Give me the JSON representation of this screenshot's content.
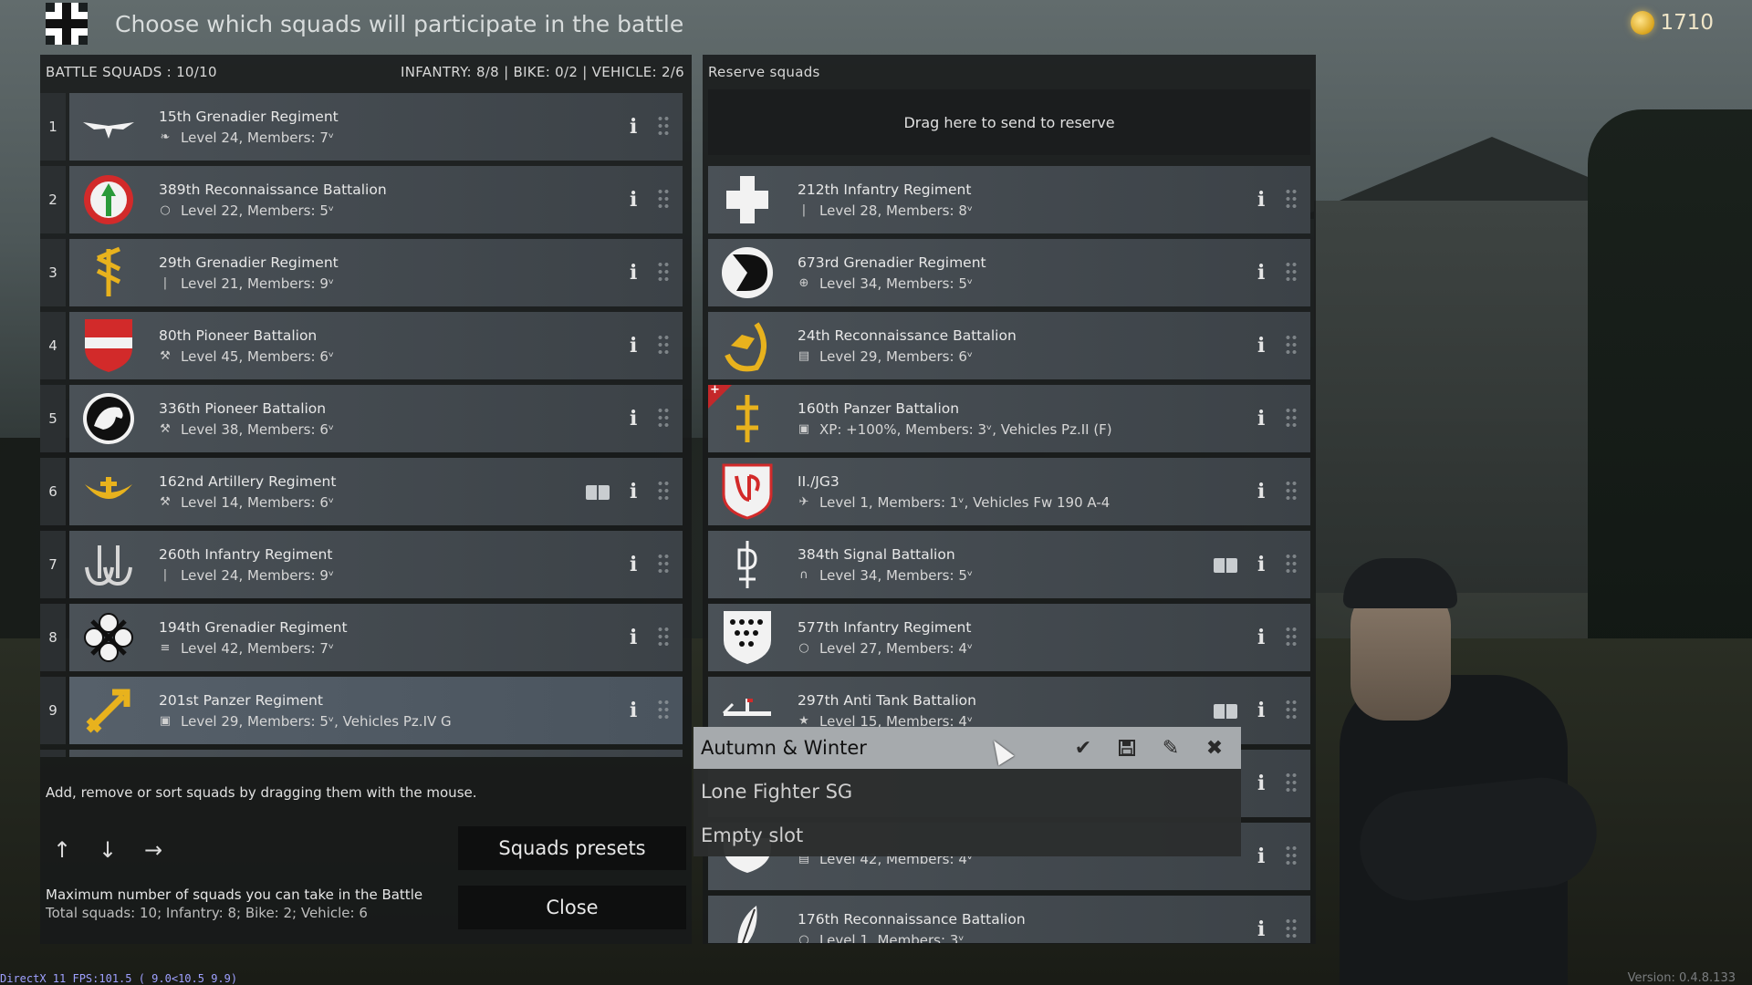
{
  "header": {
    "title": "Choose which squads will participate in the battle",
    "currency": "1710"
  },
  "battle": {
    "title": "BATTLE SQUADS : 10/10",
    "counts": "INFANTRY: 8/8 | BIKE: 0/2 | VEHICLE: 2/6",
    "rows": [
      {
        "num": "1",
        "name": "15th Grenadier Regiment",
        "meta": "Level 24, Members: 7ᵛ",
        "type_icon": "grenadier-icon",
        "emblem": "eagle"
      },
      {
        "num": "2",
        "name": "389th Reconnaissance Battalion",
        "meta": "Level 22, Members: 5ᵛ",
        "type_icon": "recon-icon",
        "emblem": "arrow-circle"
      },
      {
        "num": "3",
        "name": "29th Grenadier Regiment",
        "meta": "Level 21, Members: 9ᵛ",
        "type_icon": "rifle-icon",
        "emblem": "rune"
      },
      {
        "num": "4",
        "name": "80th Pioneer Battalion",
        "meta": "Level 45, Members: 6ᵛ",
        "type_icon": "wrench-icon",
        "emblem": "shield-red"
      },
      {
        "num": "5",
        "name": "336th Pioneer Battalion",
        "meta": "Level 38, Members: 6ᵛ",
        "type_icon": "wrench-icon",
        "emblem": "horse-head"
      },
      {
        "num": "6",
        "name": "162nd Artillery Regiment",
        "meta": "Level 14, Members: 6ᵛ",
        "type_icon": "wrench-icon",
        "emblem": "crescent"
      },
      {
        "num": "7",
        "name": "260th Infantry Regiment",
        "meta": "Level 24, Members: 9ᵛ",
        "type_icon": "rifle-icon",
        "emblem": "anchors"
      },
      {
        "num": "8",
        "name": "194th Grenadier Regiment",
        "meta": "Level 42, Members: 7ᵛ",
        "type_icon": "mg-icon",
        "emblem": "cloverleaf"
      },
      {
        "num": "9",
        "name": "201st Panzer Regiment",
        "meta": "Level 29, Members: 5ᵛ, Vehicles Pz.IV G",
        "type_icon": "tank-icon",
        "emblem": "arrow-yellow"
      }
    ],
    "help": "Add, remove or sort squads by dragging them with the mouse.",
    "limits_title": "Maximum number of squads you can take in the Battle",
    "limits_line": "Total squads: 10; Infantry: 8; Bike: 2; Vehicle: 6",
    "presets_button": "Squads presets",
    "close_button": "Close"
  },
  "reserve": {
    "title": "Reserve squads",
    "drop_zone": "Drag here to send to reserve",
    "rows": [
      {
        "name": "212th Infantry Regiment",
        "meta": "Level 28, Members: 8ᵛ",
        "type_icon": "rifle-icon",
        "emblem": "cross-white"
      },
      {
        "name": "673rd Grenadier Regiment",
        "meta": "Level 34, Members: 5ᵛ",
        "type_icon": "medic-icon",
        "emblem": "d-black"
      },
      {
        "name": "24th Reconnaissance Battalion",
        "meta": "Level 29, Members: 6ᵛ",
        "type_icon": "radio-icon",
        "emblem": "rider-yellow"
      },
      {
        "name": "160th Panzer Battalion",
        "meta": "XP: +100%, Members: 3ᵛ, Vehicles Pz.II (F)",
        "type_icon": "tank-icon",
        "emblem": "cross-yellow"
      },
      {
        "name": "II./JG3",
        "meta": "Level 1, Members: 1ᵛ, Vehicles Fw 190 A-4",
        "type_icon": "plane-icon",
        "emblem": "shield-jg3"
      },
      {
        "name": "384th Signal Battalion",
        "meta": "Level 34, Members: 5ᵛ",
        "type_icon": "headset-icon",
        "emblem": "signal-rune"
      },
      {
        "name": "577th Infantry Regiment",
        "meta": "Level 27, Members: 4ᵛ",
        "type_icon": "recon-icon",
        "emblem": "shield-dots"
      },
      {
        "name": "297th Anti Tank Battalion",
        "meta": "Level 15, Members: 4ᵛ",
        "type_icon": "at-icon",
        "emblem": "flag-at"
      },
      {
        "name": "",
        "meta": "",
        "type_icon": "",
        "emblem": ""
      },
      {
        "name": "",
        "meta": "Level 42, Members: 4ᵛ",
        "type_icon": "radio-icon",
        "emblem": "shield-white"
      },
      {
        "name": "176th Reconnaissance Battalion",
        "meta": "Level 1, Members: 3ᵛ",
        "type_icon": "recon-icon",
        "emblem": "feather"
      }
    ]
  },
  "presets": [
    {
      "label": "Autumn & Winter",
      "active": true
    },
    {
      "label": "Lone Fighter SG",
      "active": false
    },
    {
      "label": "Empty slot",
      "active": false
    }
  ],
  "footer": {
    "debug": "DirectX 11 FPS:101.5 ( 9.0<10.5 9.9)",
    "version": "Version: 0.4.8.133"
  },
  "colors": {
    "accent_gold": "#d9a41d",
    "panel_card": "#4a5157",
    "preset_active": "#a6aaad"
  }
}
